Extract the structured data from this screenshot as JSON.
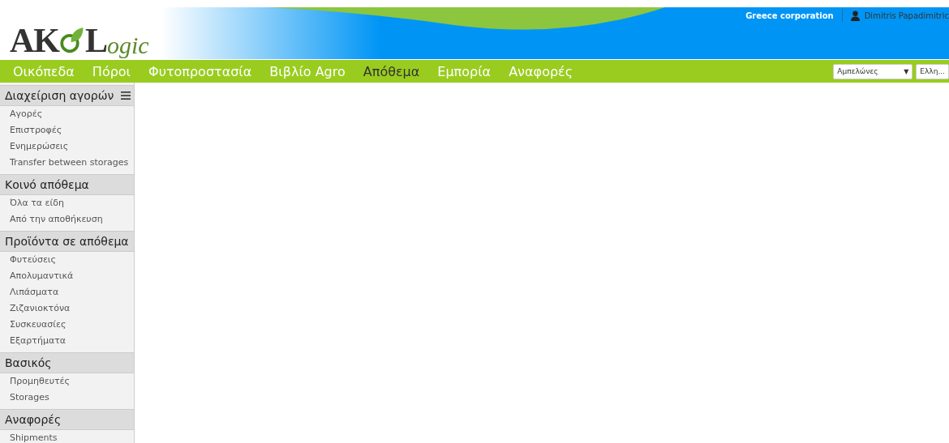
{
  "logo": {
    "first": "AK",
    "second": "L",
    "tail": "ogic"
  },
  "header": {
    "company": "Greece corporation",
    "user": "Dimitris Papadimitric"
  },
  "nav": [
    {
      "label": "Οικόπεδα",
      "selected": false
    },
    {
      "label": "Πόροι",
      "selected": false
    },
    {
      "label": "Φυτοπροστασία",
      "selected": false
    },
    {
      "label": "Βιβλίο Agro",
      "selected": false
    },
    {
      "label": "Απόθεμα",
      "selected": true
    },
    {
      "label": "Εμπορία",
      "selected": false
    },
    {
      "label": "Αναφορές",
      "selected": false
    }
  ],
  "selects": [
    {
      "value": "Αμπελώνες",
      "caret": "▼"
    },
    {
      "value": "Ελλη..."
    }
  ],
  "sidebar": [
    {
      "title": "Διαχείριση αγορών",
      "menu": true,
      "items": [
        "Αγορές",
        "Επιστροφές",
        "Ενημερώσεις",
        "Transfer between storages"
      ]
    },
    {
      "title": "Κοινό απόθεμα",
      "menu": false,
      "items": [
        "Όλα τα είδη",
        "Από την αποθήκευση"
      ]
    },
    {
      "title": "Προϊόντα σε απόθεμα",
      "menu": false,
      "items": [
        "Φυτεύσεις",
        "Απολυμαντικά",
        "Λιπάσματα",
        "Ζιζανιοκτόνα",
        "Συσκευασίες",
        "Εξαρτήματα"
      ]
    },
    {
      "title": "Βασικός",
      "menu": false,
      "items": [
        "Προμηθευτές",
        "Storages"
      ]
    },
    {
      "title": "Αναφορές",
      "menu": false,
      "items": [
        "Shipments"
      ]
    }
  ]
}
